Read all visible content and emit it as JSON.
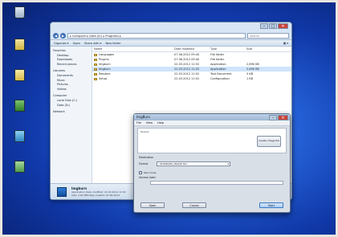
{
  "desktop": {
    "icons": [
      {
        "label": "",
        "color": "#2f7dc9"
      },
      {
        "label": "",
        "color": "#d9c243"
      },
      {
        "label": "",
        "color": "#e0c64a"
      },
      {
        "label": "",
        "color": "#3f8f3c"
      },
      {
        "label": "",
        "color": "#46a0d8"
      },
      {
        "label": "",
        "color": "#5da05a"
      }
    ]
  },
  "explorer": {
    "address": "▸ Computer ▸ Data (D:) ▸ Programs ▸",
    "search_placeholder": "Search",
    "toolbar": [
      "Organize ▾",
      "Open",
      "Share with ▾",
      "New folder"
    ],
    "nav": [
      {
        "label": "Favorites",
        "sub": false
      },
      {
        "label": "Desktop",
        "sub": true
      },
      {
        "label": "Downloads",
        "sub": true
      },
      {
        "label": "Recent places",
        "sub": true
      },
      {
        "label": "Libraries",
        "sub": false
      },
      {
        "label": "Documents",
        "sub": true
      },
      {
        "label": "Music",
        "sub": true
      },
      {
        "label": "Pictures",
        "sub": true
      },
      {
        "label": "Videos",
        "sub": true
      },
      {
        "label": "Computer",
        "sub": false
      },
      {
        "label": "Local Disk (C:)",
        "sub": true
      },
      {
        "label": "Data (D:)",
        "sub": true
      },
      {
        "label": "Network",
        "sub": false
      }
    ],
    "columns": [
      "Name",
      "Date modified",
      "Type",
      "Size"
    ],
    "files": [
      {
        "name": "Languages",
        "date": "07.06.2012 09:40",
        "type": "File folder",
        "size": "",
        "selected": false
      },
      {
        "name": "Plugins",
        "date": "07.06.2012 09:40",
        "type": "File folder",
        "size": "",
        "selected": false
      },
      {
        "name": "Imgburn",
        "date": "22.03.2012 11:52",
        "type": "Application",
        "size": "2,690 KB",
        "selected": false
      },
      {
        "name": "Imgburn",
        "date": "22.03.2012 11:52",
        "type": "Application",
        "size": "2,690 KB",
        "selected": true
      },
      {
        "name": "Readme",
        "date": "22.03.2012 11:52",
        "type": "Text Document",
        "size": "5 KB",
        "selected": false
      },
      {
        "name": "Setup",
        "date": "22.03.2012 11:52",
        "type": "Configuration",
        "size": "1 KB",
        "selected": false
      }
    ],
    "details": {
      "name": "Imgburn",
      "meta_line1": "Application    Date modified: 22.03.2012 11:52",
      "meta_line2": "Size: 2,62 MB    Date created: 07.06.2012"
    }
  },
  "dialog": {
    "title": "ImgBurn",
    "menu": [
      "File",
      "View",
      "Help"
    ],
    "panel_label": "Source",
    "side_button": "Create image file",
    "destination_label": "Destination",
    "format_label": "Format",
    "format_value": "STANDARD_IMAGE ISO",
    "check_label": "Test mode",
    "volume_label": "Volume label",
    "buttons": {
      "left": "Open",
      "middle": "Cancel",
      "right": "Start"
    }
  }
}
